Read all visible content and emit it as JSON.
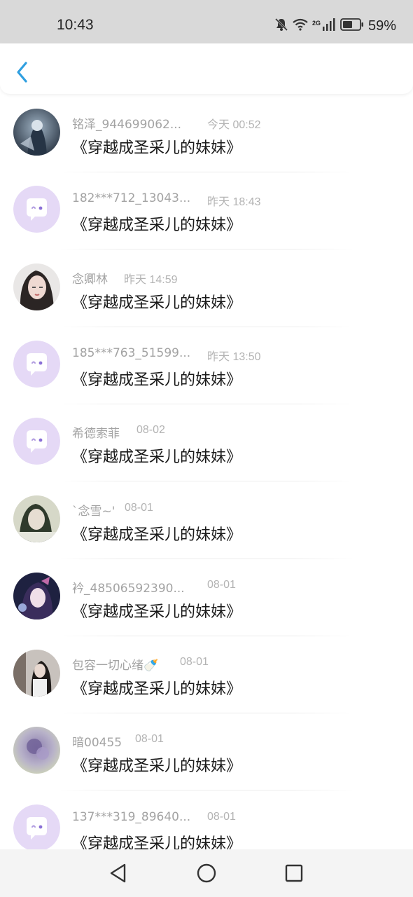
{
  "status_bar": {
    "time": "10:43",
    "network": "2G",
    "battery_percent": "59%",
    "icons": [
      "bell-off-icon",
      "wifi-icon",
      "signal-icon",
      "battery-icon"
    ]
  },
  "header": {
    "back_icon": "chevron-left-icon",
    "accent_color": "#2f9fe0"
  },
  "messages": [
    {
      "username": "铭泽_944699062...",
      "time": "今天 00:52",
      "text": "《穿越成圣采儿的妹妹》",
      "avatar": "photo-dark-anime"
    },
    {
      "username": "182***712_13043...",
      "time": "昨天 18:43",
      "text": "《穿越成圣采儿的妹妹》",
      "avatar": "default-chat-icon"
    },
    {
      "username": "念卿林",
      "time": "昨天 14:59",
      "text": "《穿越成圣采儿的妹妹》",
      "avatar": "photo-girl"
    },
    {
      "username": "185***763_51599...",
      "time": "昨天 13:50",
      "text": "《穿越成圣采儿的妹妹》",
      "avatar": "default-chat-icon"
    },
    {
      "username": "希德索菲",
      "time": "08-02",
      "text": "《穿越成圣采儿的妹妹》",
      "avatar": "default-chat-icon"
    },
    {
      "username": "`念雪~'",
      "time": "08-01",
      "text": "《穿越成圣采儿的妹妹》",
      "avatar": "photo-girl-light"
    },
    {
      "username": "衿_48506592390...",
      "time": "08-01",
      "text": "《穿越成圣采儿的妹妹》",
      "avatar": "photo-anime-purple"
    },
    {
      "username": "包容一切心绪🍼",
      "time": "08-01",
      "text": "《穿越成圣采儿的妹妹》",
      "avatar": "photo-girl-room"
    },
    {
      "username": "暗00455",
      "time": "08-01",
      "text": "《穿越成圣采儿的妹妹》",
      "avatar": "photo-flower-blur"
    },
    {
      "username": "137***319_89640...",
      "time": "08-01",
      "text": "《穿越成圣采儿的妹妹》",
      "avatar": "default-chat-icon"
    }
  ],
  "nav_bar": {
    "icons": [
      "back-triangle-icon",
      "home-circle-icon",
      "recents-square-icon"
    ]
  },
  "colors": {
    "default_avatar_bg": "#e5d9f6",
    "default_avatar_fg": "#b09be0",
    "username_color": "#a3a3a3",
    "time_color": "#b3b3b3"
  }
}
